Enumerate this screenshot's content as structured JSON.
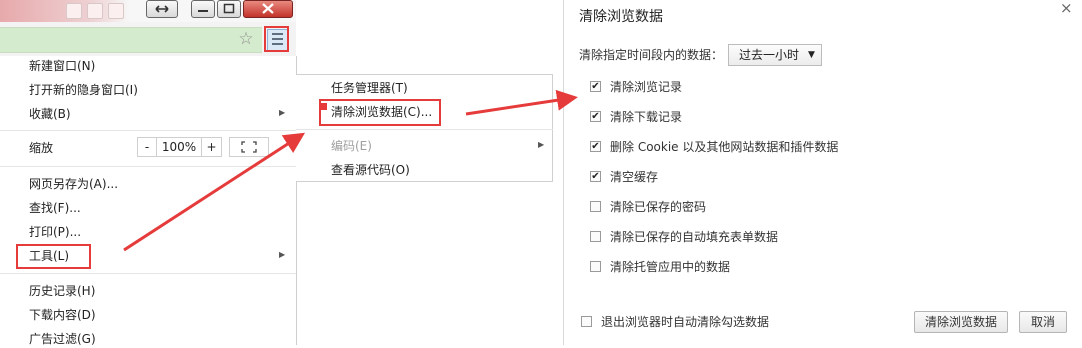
{
  "colors": {
    "highlight": "#e53b3b",
    "omnibox": "#d4ebcd",
    "menu_button": "#dbe8f6"
  },
  "icons": {
    "restore": "restore-arrows-icon",
    "minimize": "minimize-icon",
    "maximize": "maximize-icon",
    "close": "close-icon",
    "bookmark": "star-icon",
    "menu": "hamburger-menu-icon",
    "fullscreen": "fullscreen-icon",
    "submenu": "chevron-right-icon",
    "checked": "checkmark-icon",
    "dialog_close": "close-x-icon"
  },
  "browser_menu": {
    "items": {
      "new_window": "新建窗口(N)",
      "new_incognito": "打开新的隐身窗口(I)",
      "favorites": "收藏(B)",
      "zoom_label": "缩放",
      "zoom_minus": "-",
      "zoom_value": "100%",
      "zoom_plus": "+",
      "save_as": "网页另存为(A)...",
      "find": "查找(F)...",
      "print": "打印(P)...",
      "tools": "工具(L)",
      "history": "历史记录(H)",
      "downloads": "下载内容(D)",
      "ad_filter": "广告过滤(G)"
    }
  },
  "tools_submenu": {
    "task_manager": "任务管理器(T)",
    "clear_data": "清除浏览数据(C)...",
    "encoding": "编码(E)",
    "view_source": "查看源代码(O)"
  },
  "dialog": {
    "title": "清除浏览数据",
    "close_glyph": "×",
    "range_label": "清除指定时间段内的数据：",
    "range_value": "过去一小时",
    "options": [
      {
        "label": "清除浏览记录",
        "checked": true
      },
      {
        "label": "清除下载记录",
        "checked": true
      },
      {
        "label": "删除 Cookie 以及其他网站数据和插件数据",
        "checked": true
      },
      {
        "label": "清空缓存",
        "checked": true
      },
      {
        "label": "清除已保存的密码",
        "checked": false
      },
      {
        "label": "清除已保存的自动填充表单数据",
        "checked": false
      },
      {
        "label": "清除托管应用中的数据",
        "checked": false
      }
    ],
    "auto_clear_label": "退出浏览器时自动清除勾选数据",
    "auto_clear_checked": false,
    "confirm_button": "清除浏览数据",
    "cancel_button": "取消"
  }
}
